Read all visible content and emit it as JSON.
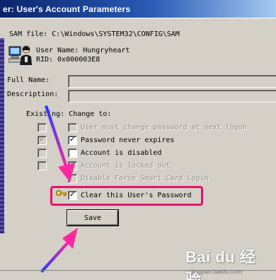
{
  "window": {
    "title": "er: User's Account Parameters"
  },
  "account": {
    "sam_file": "SAM file: C:\\Windows\\SYSTEM32\\CONFIG\\SAM",
    "user_name": "User Name: Hungryheart",
    "rid": "RID: 0x000003E8"
  },
  "fields": {
    "full_name_label": "Full Name:",
    "full_name_value": "",
    "description_label": "Description:",
    "description_value": ""
  },
  "options_header": "Existing: Change to:",
  "options": [
    {
      "label": "User must change password at next logon",
      "existing_checked": false,
      "change_checked": false,
      "enabled": false
    },
    {
      "label": "Password never expires",
      "existing_checked": true,
      "change_checked": true,
      "enabled": true
    },
    {
      "label": "Account is disabled",
      "existing_checked": false,
      "change_checked": false,
      "enabled": true
    },
    {
      "label": "Account is locked out",
      "existing_checked": false,
      "change_checked": false,
      "enabled": false
    },
    {
      "label": "Disable Force Smart Card Login",
      "existing_checked": null,
      "change_checked": false,
      "enabled": false
    }
  ],
  "clear_password": {
    "label": "Clear this User's Password",
    "checked": true
  },
  "save_button": "Save",
  "colors": {
    "highlight_border": "#e8106e",
    "arrow_gradient_start": "#1a3cff",
    "arrow_gradient_end": "#ff2aa0"
  },
  "icons": {
    "user": "user-with-computer-icon",
    "key": "key-icon",
    "check": "✓"
  },
  "watermark": {
    "brand": "Bai du 经验",
    "url": "jingyan.baidu.com"
  }
}
